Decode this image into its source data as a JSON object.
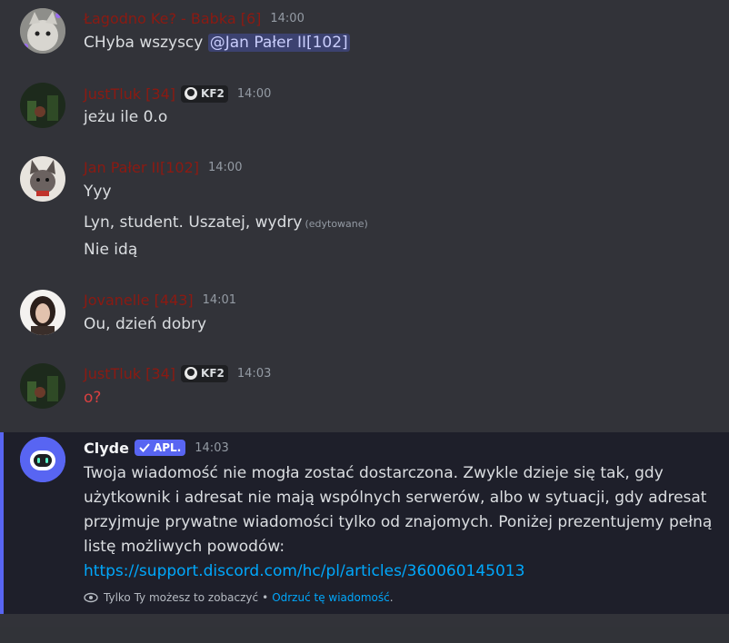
{
  "messages": [
    {
      "username": "Łagodno Ke? - Babka [6]",
      "time": "14:00",
      "lines": [
        "CHyba wszyscy"
      ],
      "mention": "@Jan Pałer II[102]"
    },
    {
      "username": "JustTluk [34]",
      "tag": "KF2",
      "time": "14:00",
      "lines": [
        "jeżu ile 0.o"
      ]
    },
    {
      "username": "Jan Pałer II[102]",
      "time": "14:00",
      "lines": [
        "Yyy",
        "Lyn, student. Uszatej, wydry",
        "Nie idą"
      ],
      "edited": "(edytowane)"
    },
    {
      "username": "Jovanelle [443]",
      "time": "14:01",
      "lines": [
        "Ou, dzień dobry"
      ]
    },
    {
      "username": "JustTluk [34]",
      "tag": "KF2",
      "time": "14:03",
      "lines": [
        "o?"
      ]
    }
  ],
  "clyde": {
    "username": "Clyde",
    "badge": "APL.",
    "time": "14:03",
    "text": "Twoja wiadomość nie mogła zostać dostarczona. Zwykle dzieje się tak, gdy użytkownik i adresat nie mają wspólnych serwerów, albo w sytuacji, gdy adresat przyjmuje prywatne wiadomości tylko od znajomych. Poniżej prezentujemy pełną listę możliwych powodów:",
    "link": "https://support.discord.com/hc/pl/articles/360060145013",
    "ephemeral_note": "Tylko Ty możesz to zobaczyć",
    "separator": "•",
    "dismiss": "Odrzuć tę wiadomość",
    "dismiss_suffix": "."
  },
  "colors": {
    "background": "#323339",
    "username": "#8b1a12",
    "link": "#00a8fc",
    "clyde_accent": "#5865f2"
  }
}
